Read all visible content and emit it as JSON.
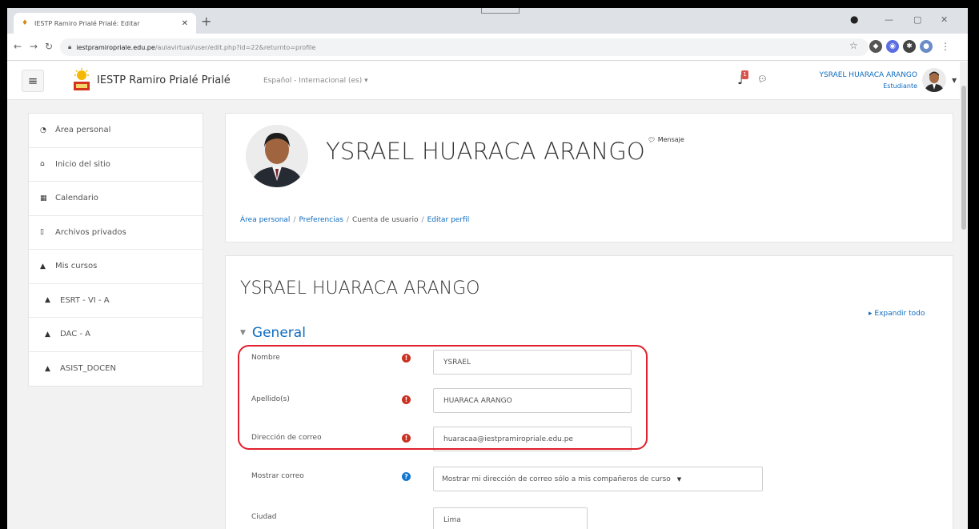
{
  "browser": {
    "tab_title": "IESTP Ramiro Prialé Prialé: Editar",
    "address": {
      "host": "iestpramiropriale.edu.pe",
      "path": "/aulavirtual/user/edit.php?id=22&returnto=profile"
    }
  },
  "navbar": {
    "site_name": "IESTP Ramiro Prialé Prialé",
    "language": "Español - Internacional (es) ▾",
    "notification_count": "1",
    "user_name": "YSRAEL HUARACA ARANGO",
    "user_role": "Estudiante"
  },
  "sidebar": {
    "items": [
      {
        "label": "Área personal",
        "icon": "dashboard-icon"
      },
      {
        "label": "Inicio del sitio",
        "icon": "home-icon"
      },
      {
        "label": "Calendario",
        "icon": "calendar-icon"
      },
      {
        "label": "Archivos privados",
        "icon": "file-icon"
      },
      {
        "label": "Mis cursos",
        "icon": "graduation-cap-icon"
      },
      {
        "label": "ESRT - VI - A",
        "icon": "graduation-cap-icon"
      },
      {
        "label": "DAC - A",
        "icon": "graduation-cap-icon"
      },
      {
        "label": "ASIST_DOCEN",
        "icon": "graduation-cap-icon"
      }
    ]
  },
  "header": {
    "full_name": "YSRAEL HUARACA ARANGO",
    "message_label": "Mensaje",
    "breadcrumb": [
      "Área personal",
      "Preferencias",
      "Cuenta de usuario",
      "Editar perfil"
    ]
  },
  "form": {
    "title": "YSRAEL HUARACA ARANGO",
    "expand_all": "Expandir todo",
    "section": "General",
    "fields": {
      "first_name": {
        "label": "Nombre",
        "value": "YSRAEL"
      },
      "last_name": {
        "label": "Apellido(s)",
        "value": "HUARACA ARANGO"
      },
      "email": {
        "label": "Dirección de correo",
        "value": "huaracaa@iestpramiropriale.edu.pe"
      },
      "email_display": {
        "label": "Mostrar correo",
        "value": "Mostrar mi dirección de correo sólo a mis compañeros de curso"
      },
      "city": {
        "label": "Ciudad",
        "value": "Lima"
      }
    }
  },
  "colors": {
    "link": "#0f6cbf",
    "required": "#ca3120",
    "help": "#1177d1",
    "highlight": "#e0202d"
  }
}
